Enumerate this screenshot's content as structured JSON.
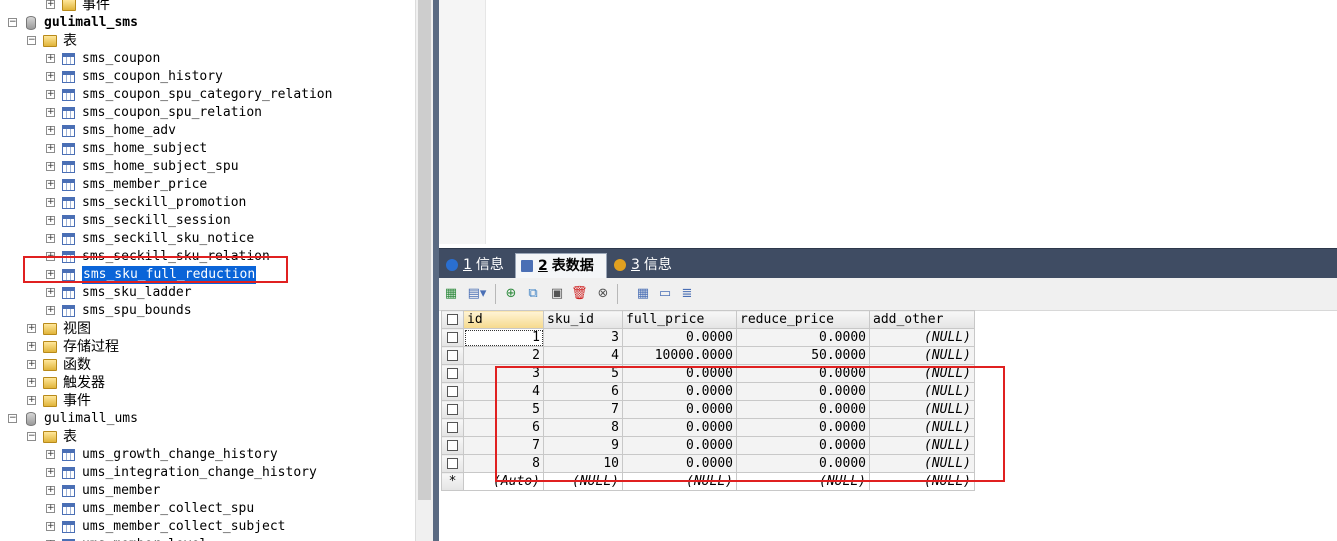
{
  "tree": {
    "items": [
      {
        "label": "事件",
        "kind": "folder",
        "level": 2,
        "expander": "+"
      },
      {
        "label": "gulimall_sms",
        "kind": "db",
        "level": 0,
        "expander": "−",
        "bold": true
      },
      {
        "label": "表",
        "kind": "folder",
        "level": 1,
        "expander": "−"
      },
      {
        "label": "sms_coupon",
        "kind": "table",
        "level": 2,
        "expander": "+"
      },
      {
        "label": "sms_coupon_history",
        "kind": "table",
        "level": 2,
        "expander": "+"
      },
      {
        "label": "sms_coupon_spu_category_relation",
        "kind": "table",
        "level": 2,
        "expander": "+"
      },
      {
        "label": "sms_coupon_spu_relation",
        "kind": "table",
        "level": 2,
        "expander": "+"
      },
      {
        "label": "sms_home_adv",
        "kind": "table",
        "level": 2,
        "expander": "+"
      },
      {
        "label": "sms_home_subject",
        "kind": "table",
        "level": 2,
        "expander": "+"
      },
      {
        "label": "sms_home_subject_spu",
        "kind": "table",
        "level": 2,
        "expander": "+"
      },
      {
        "label": "sms_member_price",
        "kind": "table",
        "level": 2,
        "expander": "+"
      },
      {
        "label": "sms_seckill_promotion",
        "kind": "table",
        "level": 2,
        "expander": "+"
      },
      {
        "label": "sms_seckill_session",
        "kind": "table",
        "level": 2,
        "expander": "+"
      },
      {
        "label": "sms_seckill_sku_notice",
        "kind": "table",
        "level": 2,
        "expander": "+"
      },
      {
        "label": "sms_seckill_sku_relation",
        "kind": "table",
        "level": 2,
        "expander": "+"
      },
      {
        "label": "sms_sku_full_reduction",
        "kind": "table",
        "level": 2,
        "expander": "+",
        "selected": true
      },
      {
        "label": "sms_sku_ladder",
        "kind": "table",
        "level": 2,
        "expander": "+"
      },
      {
        "label": "sms_spu_bounds",
        "kind": "table",
        "level": 2,
        "expander": "+"
      },
      {
        "label": "视图",
        "kind": "folder",
        "level": 1,
        "expander": "+"
      },
      {
        "label": "存储过程",
        "kind": "folder",
        "level": 1,
        "expander": "+"
      },
      {
        "label": "函数",
        "kind": "folder",
        "level": 1,
        "expander": "+"
      },
      {
        "label": "触发器",
        "kind": "folder",
        "level": 1,
        "expander": "+"
      },
      {
        "label": "事件",
        "kind": "folder",
        "level": 1,
        "expander": "+"
      },
      {
        "label": "gulimall_ums",
        "kind": "db",
        "level": 0,
        "expander": "−"
      },
      {
        "label": "表",
        "kind": "folder",
        "level": 1,
        "expander": "−"
      },
      {
        "label": "ums_growth_change_history",
        "kind": "table",
        "level": 2,
        "expander": "+"
      },
      {
        "label": "ums_integration_change_history",
        "kind": "table",
        "level": 2,
        "expander": "+"
      },
      {
        "label": "ums_member",
        "kind": "table",
        "level": 2,
        "expander": "+"
      },
      {
        "label": "ums_member_collect_spu",
        "kind": "table",
        "level": 2,
        "expander": "+"
      },
      {
        "label": "ums_member_collect_subject",
        "kind": "table",
        "level": 2,
        "expander": "+"
      },
      {
        "label": "ums_member_level",
        "kind": "table",
        "level": 2,
        "expander": "+"
      }
    ]
  },
  "tabs": [
    {
      "num": "1",
      "label": "信息",
      "icon_color": "#2a6fd1",
      "icon": "info-icon"
    },
    {
      "num": "2",
      "label": "表数据",
      "icon_color": "#4a6fb5",
      "icon": "table-data-icon",
      "active": true
    },
    {
      "num": "3",
      "label": "信息",
      "icon_color": "#e0a020",
      "icon": "info-objects-icon"
    }
  ],
  "toolbar": [
    {
      "name": "insert-row-icon",
      "glyph": "▦",
      "color": "#2e8b3d"
    },
    {
      "name": "export-dropdown-icon",
      "glyph": "▤▾",
      "color": "#4a6fb5"
    },
    {
      "name": "add-row-icon",
      "glyph": "⊕",
      "color": "#2e8b3d"
    },
    {
      "name": "duplicate-row-icon",
      "glyph": "⧉",
      "color": "#3a7fc4"
    },
    {
      "name": "save-icon",
      "glyph": "▣",
      "color": "#555555"
    },
    {
      "name": "delete-icon",
      "glyph": "🗑",
      "color": "#d02020"
    },
    {
      "name": "cancel-icon",
      "glyph": "⊗",
      "color": "#555555"
    },
    {
      "name": "grid-view-icon",
      "glyph": "▦",
      "color": "#4a6fb5"
    },
    {
      "name": "form-view-icon",
      "glyph": "▭",
      "color": "#4a6fb5"
    },
    {
      "name": "text-view-icon",
      "glyph": "≣",
      "color": "#4a6fb5"
    }
  ],
  "grid": {
    "columns": [
      "id",
      "sku_id",
      "full_price",
      "reduce_price",
      "add_other"
    ],
    "rows": [
      [
        "1",
        "3",
        "0.0000",
        "0.0000",
        "(NULL)"
      ],
      [
        "2",
        "4",
        "10000.0000",
        "50.0000",
        "(NULL)"
      ],
      [
        "3",
        "5",
        "0.0000",
        "0.0000",
        "(NULL)"
      ],
      [
        "4",
        "6",
        "0.0000",
        "0.0000",
        "(NULL)"
      ],
      [
        "5",
        "7",
        "0.0000",
        "0.0000",
        "(NULL)"
      ],
      [
        "6",
        "8",
        "0.0000",
        "0.0000",
        "(NULL)"
      ],
      [
        "7",
        "9",
        "0.0000",
        "0.0000",
        "(NULL)"
      ],
      [
        "8",
        "10",
        "0.0000",
        "0.0000",
        "(NULL)"
      ]
    ],
    "new_row_marker": "*",
    "new_row": [
      "(Auto)",
      "(NULL)",
      "(NULL)",
      "(NULL)",
      "(NULL)"
    ]
  }
}
